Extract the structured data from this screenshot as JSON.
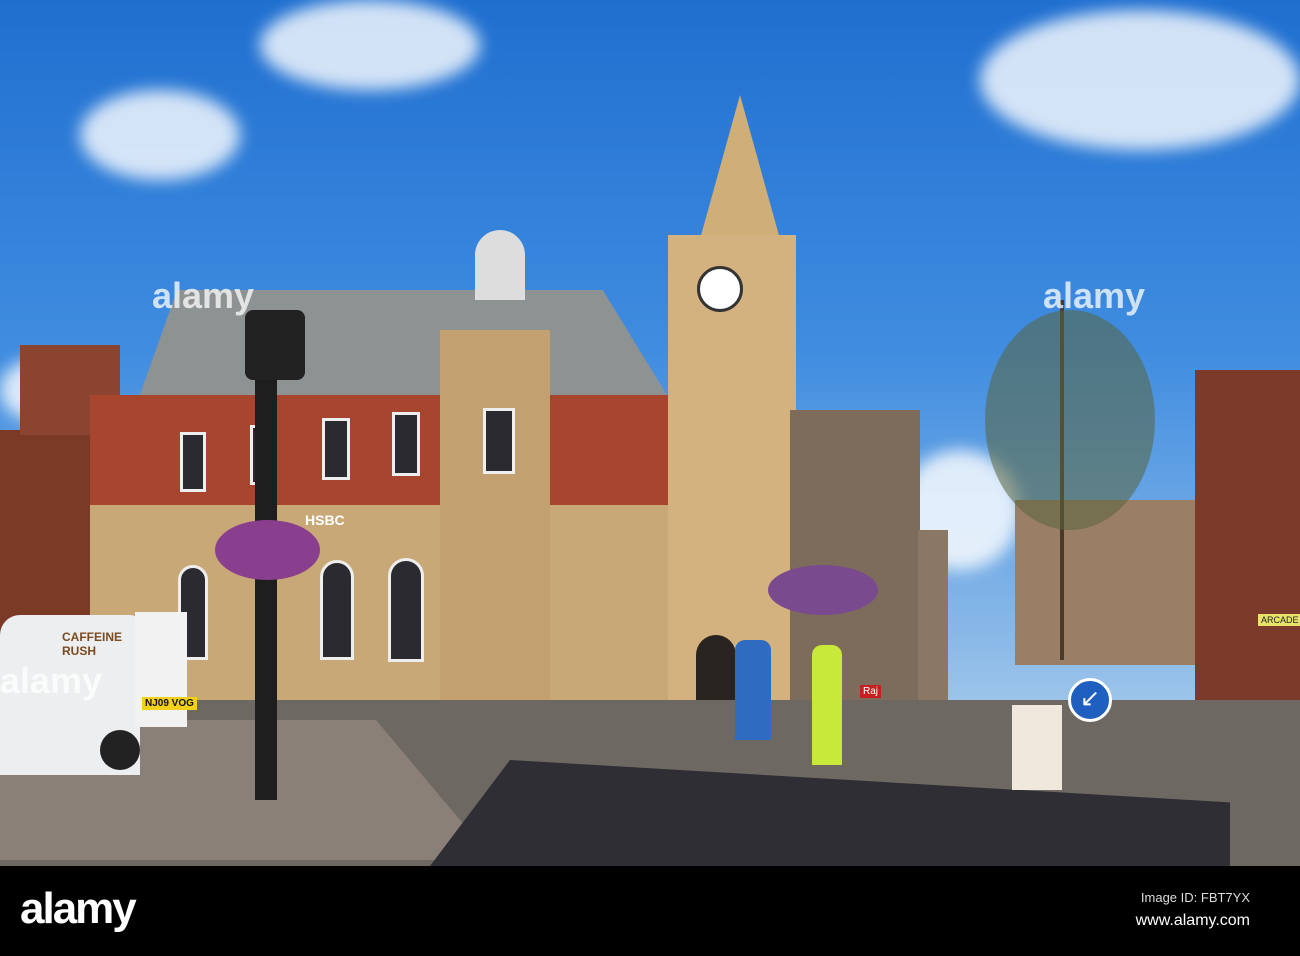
{
  "watermark": {
    "brand": "alamy",
    "image_id": "Image ID: FBT7YX",
    "url": "www.alamy.com"
  },
  "signs": {
    "bank": "HSBC",
    "van": "CAFFEINE RUSH",
    "plate": "NJ09 VOG",
    "arcade": "ARCADE",
    "restaurant": "Raj"
  },
  "colors": {
    "sky": "#2f7fd8",
    "stone": "#c9a878",
    "brick": "#a8452e",
    "road": "#6e6862"
  }
}
